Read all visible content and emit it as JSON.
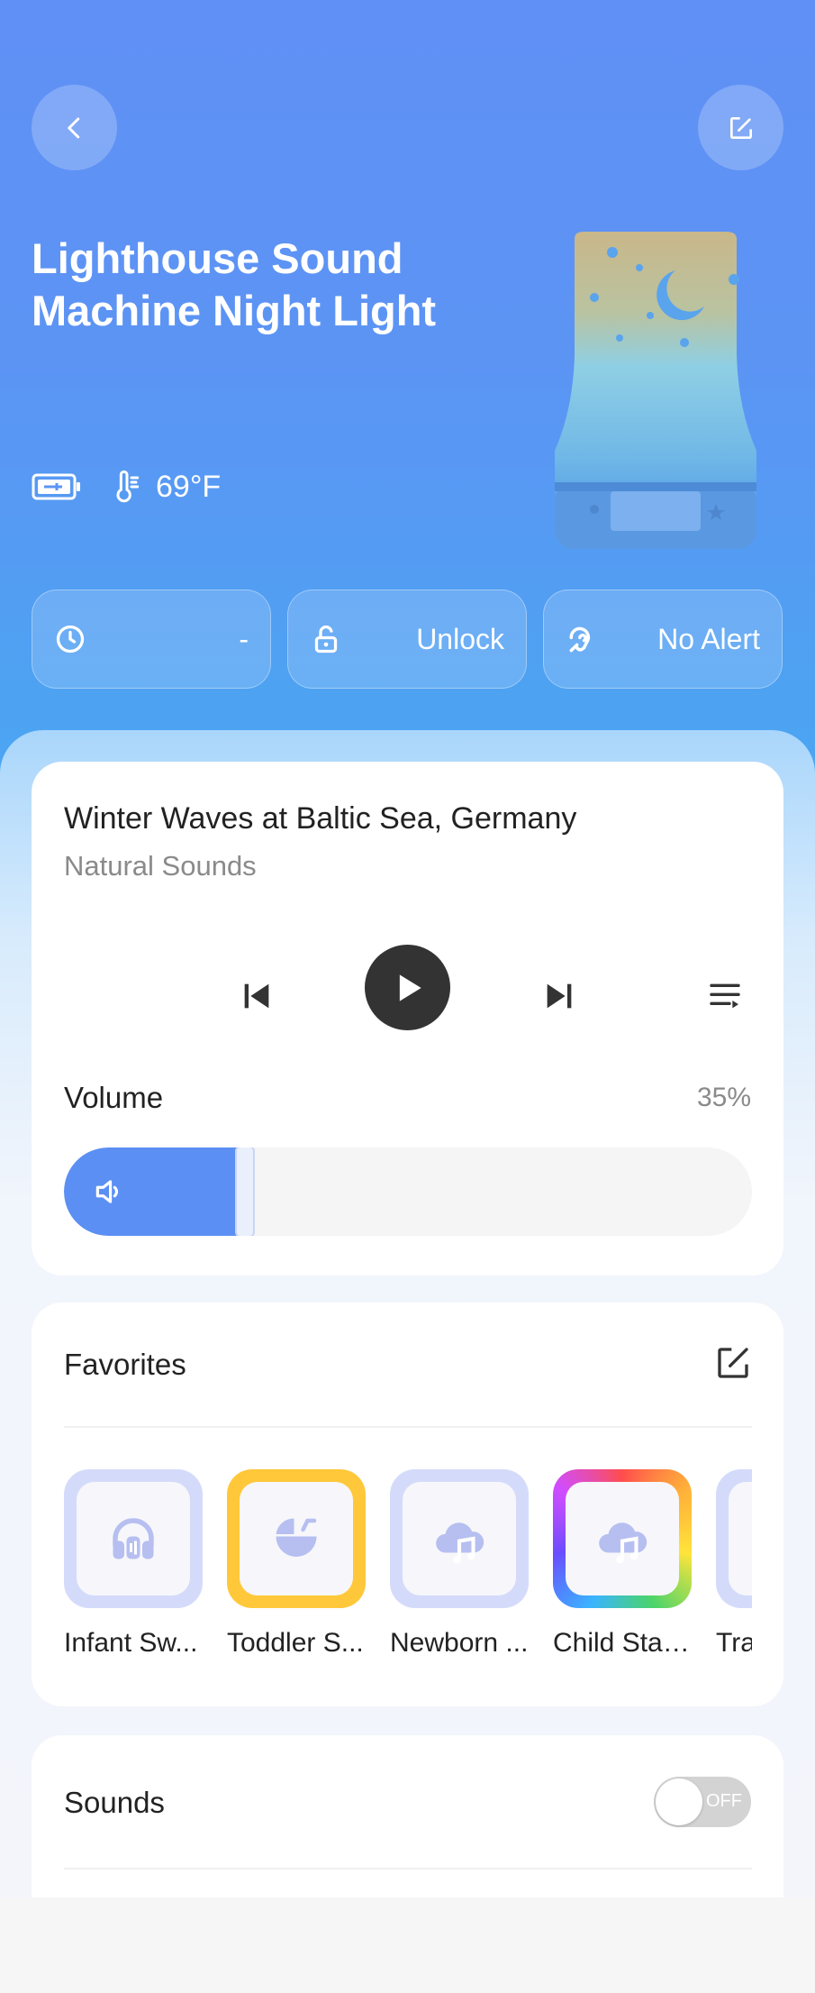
{
  "header": {
    "title": "Lighthouse Sound Machine Night Light",
    "back_icon": "chevron-left-icon",
    "edit_icon": "edit-icon"
  },
  "status": {
    "battery_icon": "battery-charging-icon",
    "temperature": "69°F"
  },
  "quick_actions": [
    {
      "icon": "clock-icon",
      "value": "-"
    },
    {
      "icon": "unlock-icon",
      "value": "Unlock"
    },
    {
      "icon": "ear-icon",
      "value": "No Alert"
    }
  ],
  "player": {
    "track_title": "Winter Waves at Baltic Sea, Germany",
    "track_category": "Natural Sounds",
    "volume_label": "Volume",
    "volume_value": "35%",
    "volume_level": 0.35
  },
  "favorites": {
    "title": "Favorites",
    "items": [
      {
        "label": "Infant Sw...",
        "icon": "headphones-icon"
      },
      {
        "label": "Toddler S...",
        "icon": "baby-stroller-icon"
      },
      {
        "label": "Newborn ...",
        "icon": "cloud-music-icon"
      },
      {
        "label": "Child Star...",
        "icon": "cloud-music-icon"
      },
      {
        "label": "Tra",
        "icon": "cloud-music-icon"
      }
    ]
  },
  "sounds": {
    "title": "Sounds",
    "toggle_state": "OFF"
  },
  "colors": {
    "accent": "#5b8ff3",
    "hero_top": "#6090f5",
    "selected_border": "#ffc83a"
  }
}
